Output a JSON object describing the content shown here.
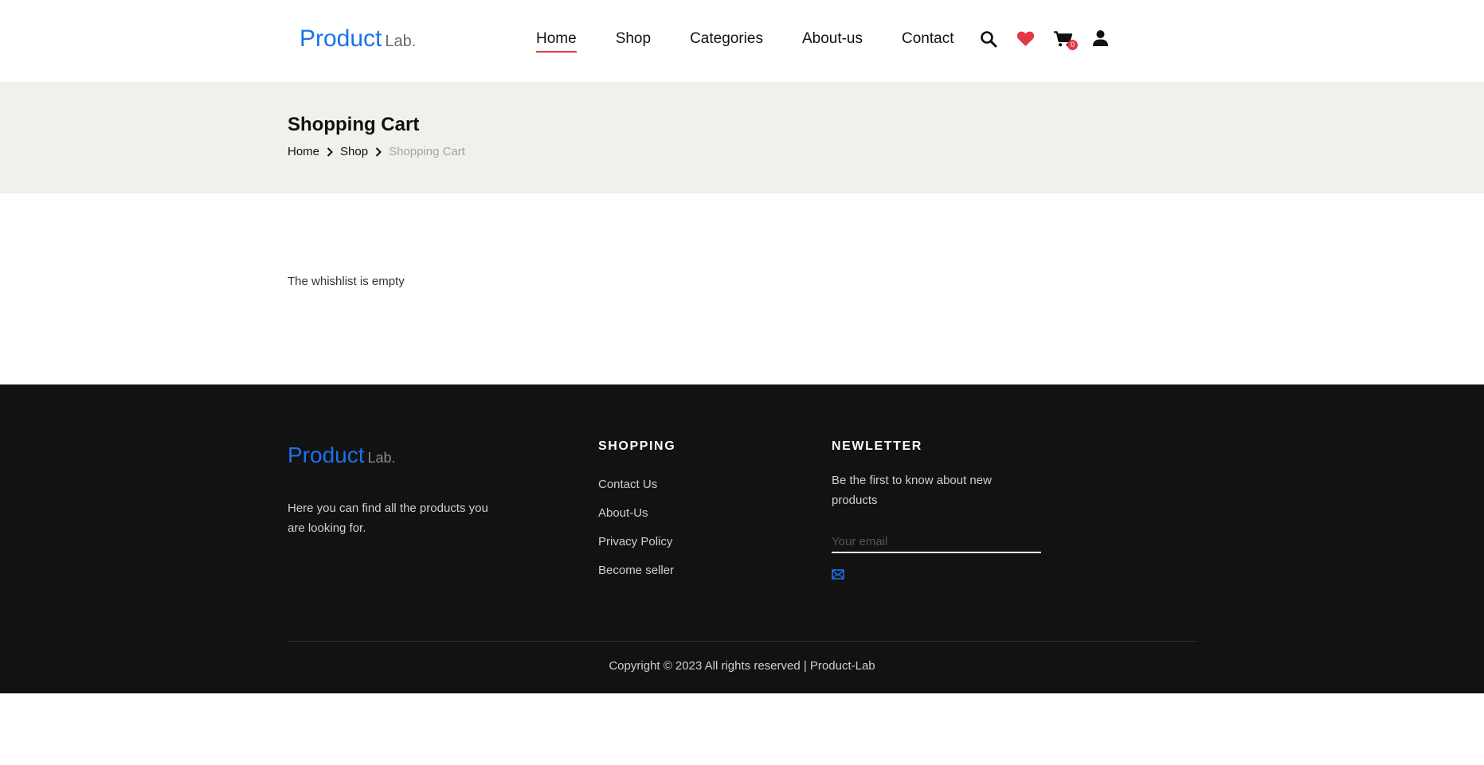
{
  "header": {
    "logo_main": "Product",
    "logo_sub": "Lab.",
    "nav": [
      {
        "label": "Home",
        "active": true
      },
      {
        "label": "Shop",
        "active": false
      },
      {
        "label": "Categories",
        "active": false
      },
      {
        "label": "About-us",
        "active": false
      },
      {
        "label": "Contact",
        "active": false
      }
    ],
    "icons": {
      "search": "search-icon",
      "wishlist": "heart-icon",
      "cart": "cart-icon",
      "account": "user-icon"
    },
    "cart_count": "0"
  },
  "banner": {
    "title": "Shopping Cart",
    "breadcrumb": [
      "Home",
      "Shop",
      "Shopping Cart"
    ]
  },
  "main": {
    "empty_message": "The whishlist is empty"
  },
  "footer": {
    "logo_main": "Product",
    "logo_sub": "Lab.",
    "description": "Here you can find all the products you are looking for.",
    "shopping": {
      "heading": "SHOPPING",
      "links": [
        "Contact Us",
        "About-Us",
        "Privacy Policy",
        "Become seller"
      ]
    },
    "newsletter": {
      "heading": "NEWLETTER",
      "text": "Be the first to know about new products",
      "email_placeholder": "Your email",
      "send_icon": "envelope-icon"
    },
    "copyright": "Copyright © 2023 All rights reserved | Product-Lab"
  },
  "colors": {
    "brand_blue": "#1a73e8",
    "accent_red": "#e23744",
    "banner_bg": "#f2f0ec",
    "footer_bg": "#121212"
  }
}
